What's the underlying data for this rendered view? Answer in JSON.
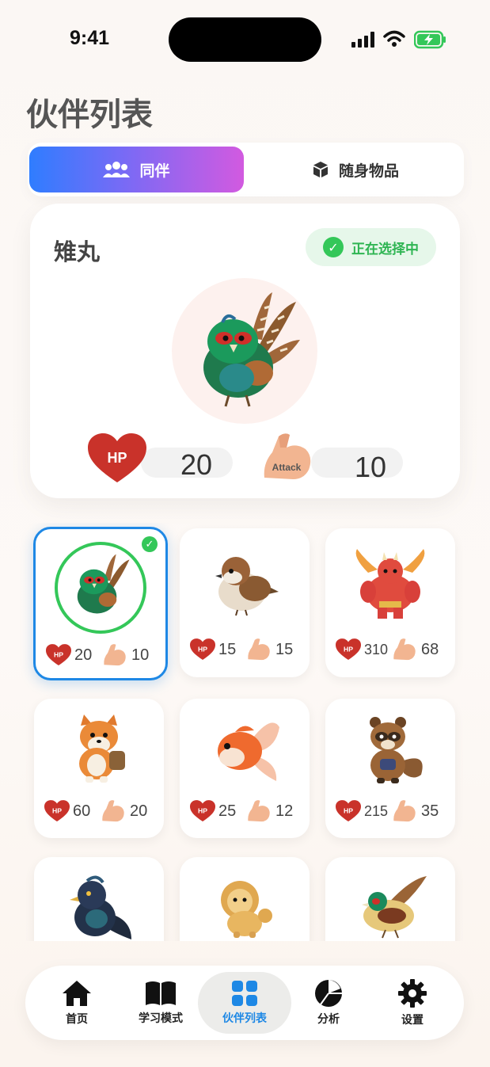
{
  "status_bar": {
    "time": "9:41"
  },
  "page_title": "伙伴列表",
  "segment": {
    "tabs": [
      {
        "label": "同伴",
        "icon": "people-icon",
        "active": true
      },
      {
        "label": "随身物品",
        "icon": "box-icon",
        "active": false
      }
    ]
  },
  "selected": {
    "name": "雉丸",
    "badge": "正在选择中",
    "hp": "20",
    "attack": "10",
    "hp_icon_text": "HP",
    "attack_icon_text": "Attack"
  },
  "companions": [
    {
      "creature": "pheasant",
      "hp": "20",
      "attack": "10",
      "selected": true
    },
    {
      "creature": "sparrow",
      "hp": "15",
      "attack": "15",
      "selected": false
    },
    {
      "creature": "red-oni",
      "hp": "310",
      "attack": "68",
      "selected": false
    },
    {
      "creature": "shiba-dog",
      "hp": "60",
      "attack": "20",
      "selected": false
    },
    {
      "creature": "goldfish",
      "hp": "25",
      "attack": "12",
      "selected": false
    },
    {
      "creature": "tanuki",
      "hp": "215",
      "attack": "35",
      "selected": false
    },
    {
      "creature": "black-bird",
      "selected": false
    },
    {
      "creature": "golden-lion",
      "selected": false
    },
    {
      "creature": "phoenix-pheasant",
      "selected": false
    }
  ],
  "nav": {
    "items": [
      {
        "label": "首页",
        "icon": "home-icon"
      },
      {
        "label": "学习模式",
        "icon": "book-icon"
      },
      {
        "label": "伙伴列表",
        "icon": "grid-icon",
        "active": true
      },
      {
        "label": "分析",
        "icon": "pie-chart-icon"
      },
      {
        "label": "设置",
        "icon": "gear-icon"
      }
    ]
  },
  "colors": {
    "accent": "#1e88e5",
    "success": "#34c759",
    "hp_red": "#d33a2c"
  }
}
